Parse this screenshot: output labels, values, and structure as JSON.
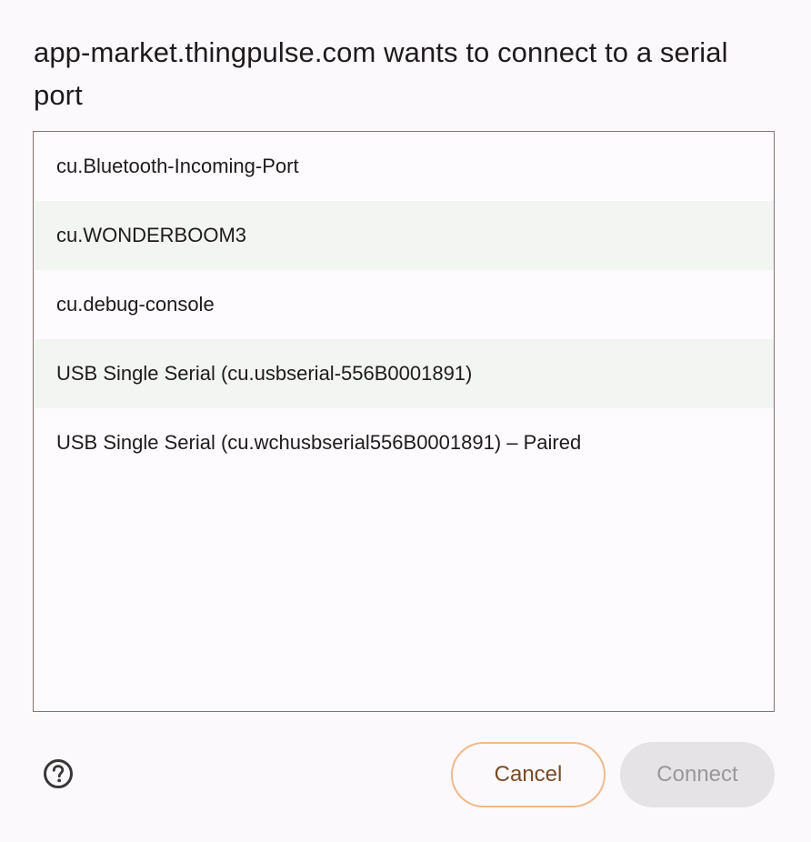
{
  "dialog": {
    "title": "app-market.thingpulse.com wants to connect to a serial port"
  },
  "ports": [
    {
      "label": "cu.Bluetooth-Incoming-Port"
    },
    {
      "label": "cu.WONDERBOOM3"
    },
    {
      "label": "cu.debug-console"
    },
    {
      "label": "USB Single Serial (cu.usbserial-556B0001891)"
    },
    {
      "label": "USB Single Serial (cu.wchusbserial556B0001891) – Paired"
    }
  ],
  "footer": {
    "help_icon": "help-circle-icon",
    "cancel_label": "Cancel",
    "connect_label": "Connect",
    "connect_enabled": false
  },
  "colors": {
    "cancel_border": "#f0b98d",
    "cancel_text": "#7a4a25",
    "connect_disabled_bg": "#e6e3e6",
    "connect_disabled_text": "#9a9799",
    "alt_row": "#f2f5f1"
  }
}
